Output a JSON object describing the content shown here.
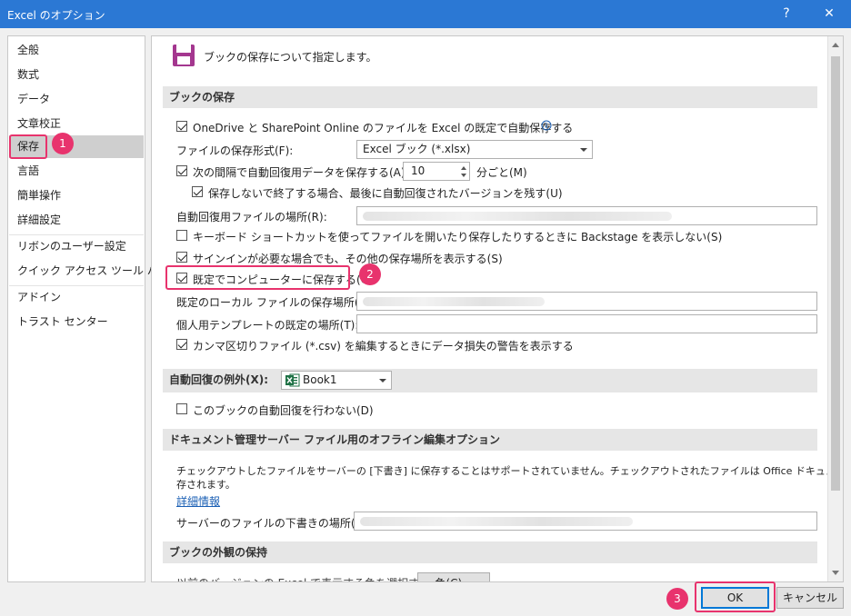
{
  "window": {
    "title": "Excel のオプション",
    "help": "?",
    "close": "✕"
  },
  "sidebar": {
    "items": [
      {
        "label": "全般"
      },
      {
        "label": "数式"
      },
      {
        "label": "データ"
      },
      {
        "label": "文章校正"
      },
      {
        "label": "保存"
      },
      {
        "label": "言語"
      },
      {
        "label": "簡単操作"
      },
      {
        "label": "詳細設定"
      },
      {
        "label": "リボンのユーザー設定"
      },
      {
        "label": "クイック アクセス ツール バー"
      },
      {
        "label": "アドイン"
      },
      {
        "label": "トラスト センター"
      }
    ],
    "selected": "保存"
  },
  "main": {
    "heading": "ブックの保存について指定します。",
    "save_section": {
      "title": "ブックの保存",
      "autosave_label": "OneDrive と SharePoint Online のファイルを Excel の既定で自動保存する",
      "autosave_checked": true,
      "format_label": "ファイルの保存形式(F):",
      "format_value": "Excel ブック (*.xlsx)",
      "autorecover_label": "次の間隔で自動回復用データを保存する(A):",
      "autorecover_checked": true,
      "autorecover_minutes": "10",
      "autorecover_unit": "分ごと(M)",
      "keep_last_label": "保存しないで終了する場合、最後に自動回復されたバージョンを残す(U)",
      "keep_last_checked": true,
      "autorecover_location_label": "自動回復用ファイルの場所(R):",
      "backstage_label": "キーボード ショートカットを使ってファイルを開いたり保存したりするときに Backstage を表示しない(S)",
      "backstage_checked": false,
      "show_more_label": "サインインが必要な場合でも、その他の保存場所を表示する(S)",
      "show_more_checked": true,
      "save_to_computer_label": "既定でコンピューターに保存する(C)",
      "save_to_computer_checked": true,
      "local_location_label": "既定のローカル ファイルの保存場所(I):",
      "template_location_label": "個人用テンプレートの既定の場所(T):",
      "csv_warning_label": "カンマ区切りファイル (*.csv) を編集するときにデータ損失の警告を表示する",
      "csv_warning_checked": true
    },
    "exceptions_section": {
      "title": "自動回復の例外(X):",
      "book_value": "Book1",
      "disable_label": "このブックの自動回復を行わない(D)",
      "disable_checked": false
    },
    "offline_section": {
      "title": "ドキュメント管理サーバー ファイル用のオフライン編集オプション",
      "description_line1": "チェックアウトしたファイルをサーバーの [下書き] に保存することはサポートされていません。チェックアウトされたファイルは Office ドキュメント キャッシュに保",
      "description_line2": "存されます。",
      "more_info": "詳細情報",
      "drafts_location_label": "サーバーのファイルの下書きの場所(V):"
    },
    "appearance_section": {
      "title": "ブックの外観の保持",
      "partial_label": "以前のバージョンの Excel で表示する色を選択する:",
      "color_button": "色(C)..."
    }
  },
  "footer": {
    "ok": "OK",
    "cancel": "キャンセル"
  },
  "annotations": {
    "step1": "1",
    "step2": "2",
    "step3": "3"
  },
  "colors": {
    "titlebar": "#2b78d4",
    "highlight": "#e8336d",
    "excel_green": "#1e7145",
    "save_icon": "#a4378f"
  }
}
